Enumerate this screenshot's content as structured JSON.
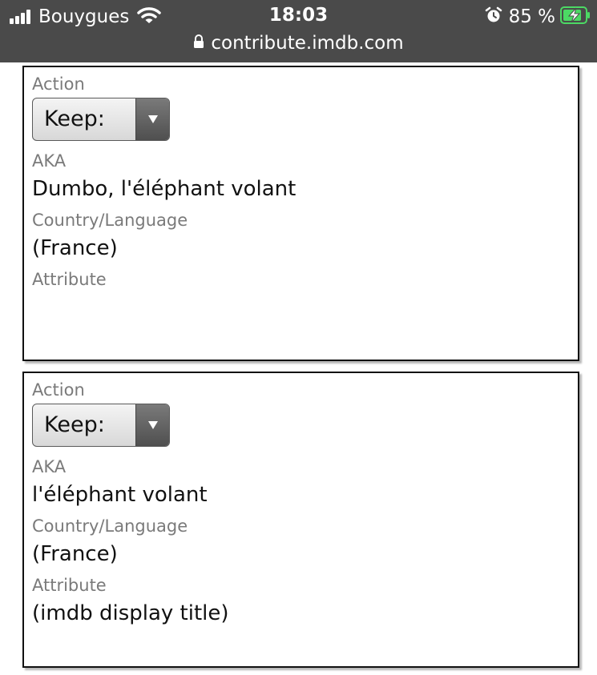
{
  "status_bar": {
    "carrier": "Bouygues",
    "time": "18:03",
    "battery_percent": "85 %",
    "url": "contribute.imdb.com",
    "signal_bars": 4,
    "icons": [
      "signal-icon",
      "wifi-icon",
      "alarm-icon",
      "battery-charging-icon",
      "lock-icon"
    ]
  },
  "entries": [
    {
      "action_label": "Action",
      "action_value": "Keep:",
      "aka_label": "AKA",
      "aka_value": "Dumbo, l'éléphant volant",
      "country_label": "Country/Language",
      "country_value": "(France)",
      "attribute_label": "Attribute",
      "attribute_value": ""
    },
    {
      "action_label": "Action",
      "action_value": "Keep:",
      "aka_label": "AKA",
      "aka_value": "l'éléphant volant",
      "country_label": "Country/Language",
      "country_value": "(France)",
      "attribute_label": "Attribute",
      "attribute_value": "(imdb display title)"
    }
  ],
  "colors": {
    "status_bar_bg": "#4a4a4a",
    "battery_accent": "#4cd964",
    "label_gray": "#7a7a7a"
  }
}
